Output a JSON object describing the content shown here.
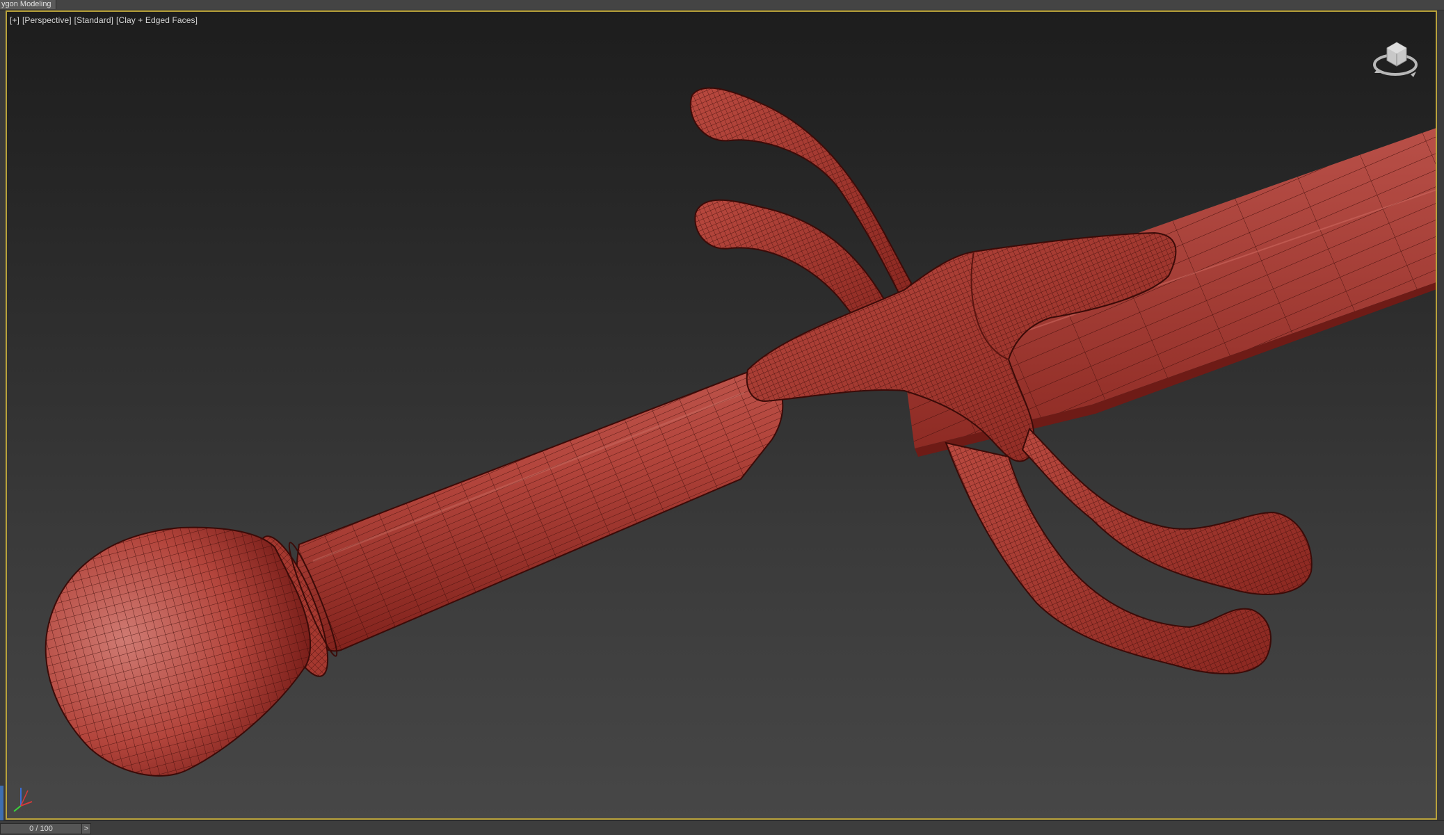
{
  "ribbon": {
    "active_tab_label": "ygon Modeling"
  },
  "viewport": {
    "label_plus": "[+]",
    "label_view": "[Perspective]",
    "label_shading_preset": "[Standard]",
    "label_display_mode": "[Clay + Edged Faces]",
    "active_border_color": "#b9a23b",
    "model_color": "#b6403a",
    "wire_color": "#3b0b08"
  },
  "timeline": {
    "frame_readout": "0 / 100",
    "next_button_glyph": ">"
  },
  "icons": {
    "viewcube": "viewcube-icon",
    "axis": "axis-tripod-icon"
  }
}
